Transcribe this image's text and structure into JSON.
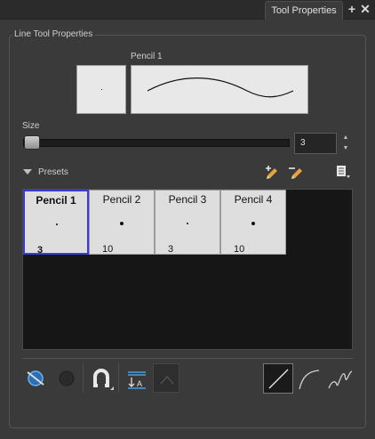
{
  "window": {
    "tab_title": "Tool Properties",
    "add_icon": "plus-icon",
    "close_icon": "close-icon"
  },
  "panel": {
    "title": "Line Tool Properties"
  },
  "preview": {
    "label": "Pencil 1"
  },
  "size": {
    "label": "Size",
    "value": "3",
    "slider_fraction": 0.03
  },
  "presets": {
    "label": "Presets",
    "new_icon": "new-preset-icon",
    "rename_icon": "rename-preset-icon",
    "menu_icon": "presets-menu-icon",
    "items": [
      {
        "name": "Pencil 1",
        "size": "3",
        "selected": true
      },
      {
        "name": "Pencil 2",
        "size": "10",
        "selected": false
      },
      {
        "name": "Pencil 3",
        "size": "3",
        "selected": false
      },
      {
        "name": "Pencil 4",
        "size": "10",
        "selected": false
      }
    ]
  },
  "toolbar": {
    "buttons": [
      "auto-flatten-icon",
      "auto-fill-icon",
      "snap-icon",
      "arrange-icon",
      "join-icon"
    ],
    "stroke_modes": [
      "straight-line-icon",
      "curve-line-icon",
      "freehand-line-icon"
    ]
  },
  "colors": {
    "background": "#3a3a3a",
    "preset_selected_border": "#3b3bd0",
    "accent_blue": "#4a9fe0",
    "accent_orange": "#e8a040"
  }
}
